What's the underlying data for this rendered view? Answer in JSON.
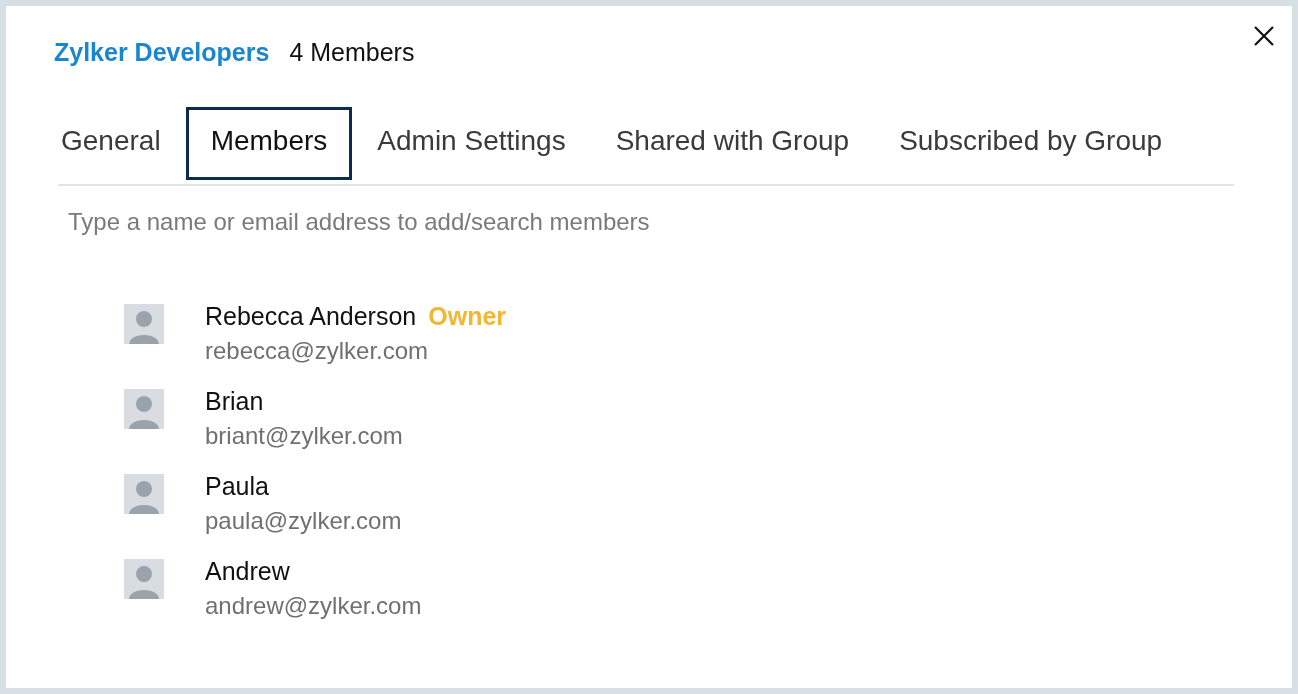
{
  "header": {
    "group_name": "Zylker Developers",
    "member_count": "4 Members"
  },
  "tabs": [
    {
      "label": "General",
      "selected": false
    },
    {
      "label": "Members",
      "selected": true
    },
    {
      "label": "Admin Settings",
      "selected": false
    },
    {
      "label": "Shared with Group",
      "selected": false
    },
    {
      "label": "Subscribed by Group",
      "selected": false
    }
  ],
  "search": {
    "placeholder": "Type a name or email address to add/search members"
  },
  "members": [
    {
      "name": "Rebecca Anderson",
      "role": "Owner",
      "email": "rebecca@zylker.com"
    },
    {
      "name": "Brian",
      "email": "briant@zylker.com"
    },
    {
      "name": "Paula",
      "email": "paula@zylker.com"
    },
    {
      "name": "Andrew",
      "email": "andrew@zylker.com"
    }
  ]
}
